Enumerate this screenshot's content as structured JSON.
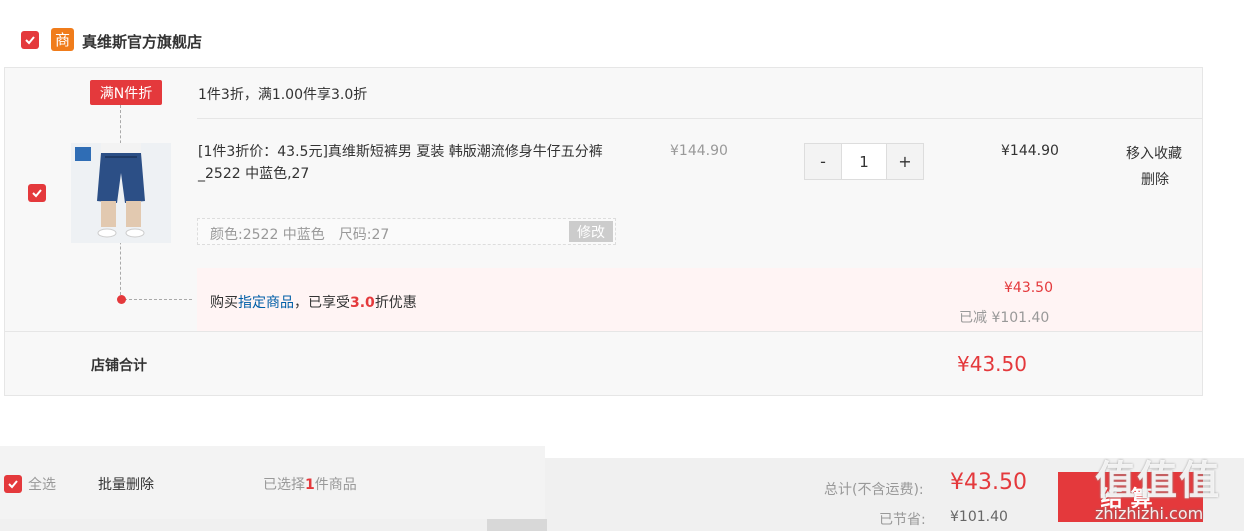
{
  "shop": {
    "badge": "商",
    "name": "真维斯官方旗舰店"
  },
  "promo": {
    "tag": "满N件折",
    "text": "1件3折，满1.00件享3.0折"
  },
  "item": {
    "title": "[1件3折价：43.5元]真维斯短裤男 夏装 韩版潮流修身牛仔五分裤_2522 中蓝色,27",
    "attributes": "颜色:2522 中蓝色　尺码:27",
    "edit_label": "修改",
    "unit_price": "¥144.90",
    "quantity": "1",
    "minus": "-",
    "plus": "+",
    "subtotal": "¥144.90",
    "move_to_favorites": "移入收藏",
    "delete": "删除"
  },
  "promo_result": {
    "prefix": "购买",
    "link": "指定商品",
    "middle": "，已享受",
    "discount": "3.0",
    "suffix": "折优惠",
    "price": "¥43.50",
    "saved": "已减 ¥101.40"
  },
  "shop_total": {
    "label": "店铺合计",
    "amount": "¥43.50"
  },
  "footer": {
    "select_all": "全选",
    "batch_delete": "批量删除",
    "selected_prefix": "已选择",
    "selected_count": "1",
    "selected_suffix": "件商品",
    "total_label": "总计(不含运费):",
    "total_amount": "¥43.50",
    "saved_label": "已节省:",
    "saved_amount": "¥101.40",
    "checkout": "结算"
  },
  "watermark": {
    "text": "值值值",
    "url": "zhizhizhi.com"
  },
  "colors": {
    "accent": "#e4393c",
    "shop_badge": "#f07c1b",
    "link": "#005ea7"
  }
}
